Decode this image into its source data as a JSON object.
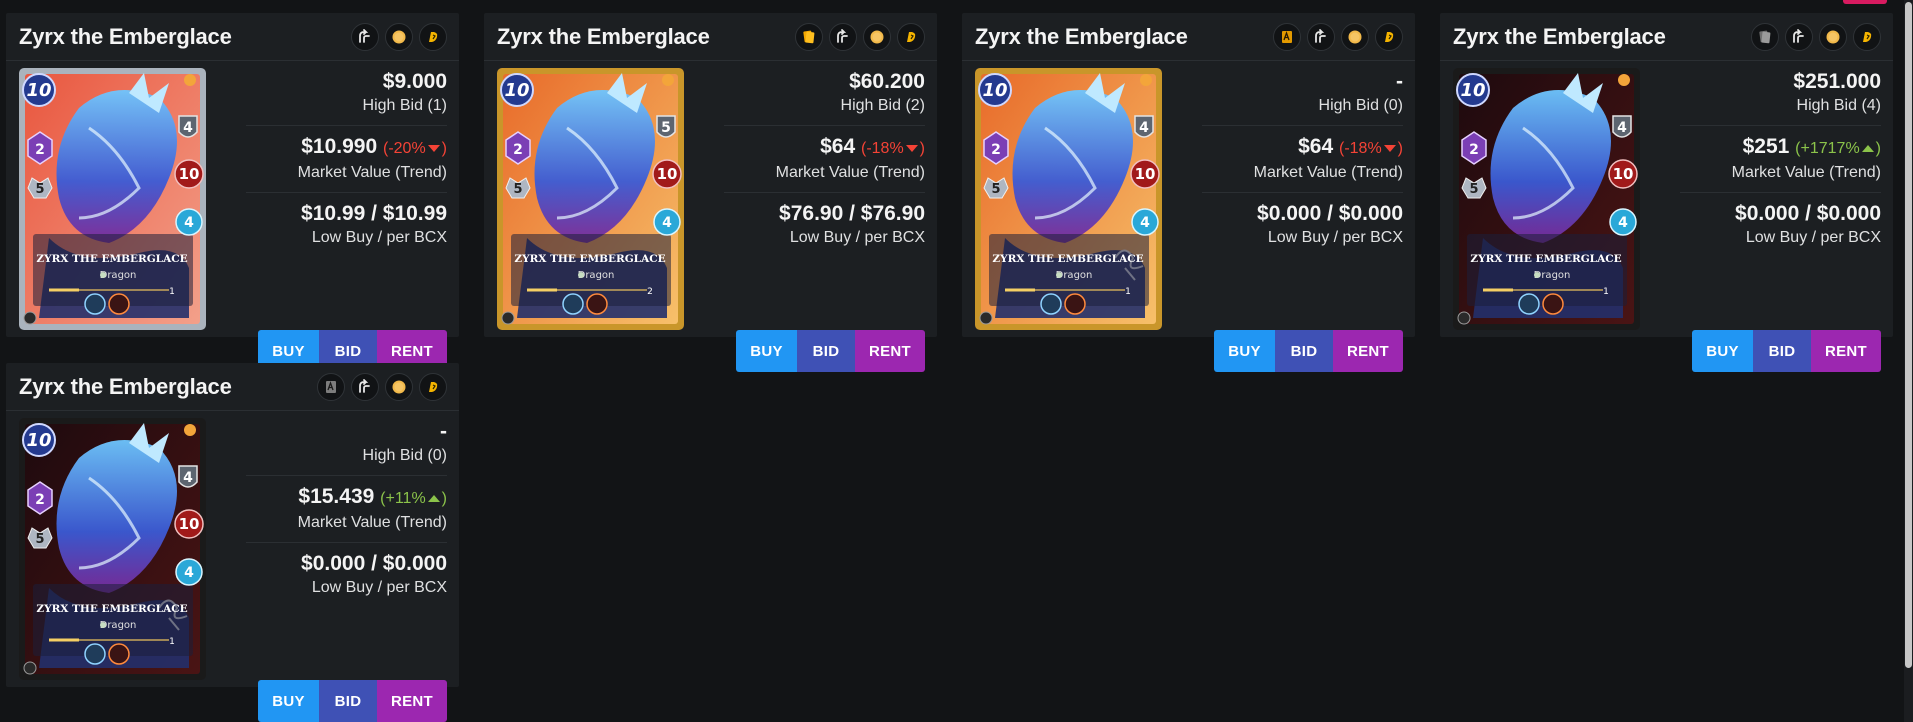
{
  "cards": [
    {
      "name": "Zyrx the Emberglace",
      "badges": [
        "splinterlands-icon",
        "credits-coin-icon",
        "dec-icon"
      ],
      "edition_variant": "alpha-silver",
      "card_art": {
        "mana": "10",
        "armor": "4",
        "magic": "2",
        "attack": "10",
        "speed": "5",
        "health": "4",
        "title": "ZYRX THE EMBERGLACE",
        "type": "Dragon",
        "level": "1"
      },
      "high_bid_price": "$9.000",
      "high_bid_label": "High Bid (1)",
      "market_value": "$10.990",
      "trend": "(-20%",
      "trend_dir": "down",
      "trend_close": ")",
      "market_label": "Market Value (Trend)",
      "low_buy": "$10.99 / $10.99",
      "low_buy_label": "Low Buy / per BCX"
    },
    {
      "name": "Zyrx the Emberglace",
      "badges": [
        "gold-card-icon",
        "splinterlands-icon",
        "credits-coin-icon",
        "dec-icon"
      ],
      "edition_variant": "gold",
      "card_art": {
        "mana": "10",
        "armor": "5",
        "magic": "2",
        "attack": "10",
        "speed": "5",
        "health": "4",
        "title": "ZYRX THE EMBERGLACE",
        "type": "Dragon",
        "level": "2"
      },
      "high_bid_price": "$60.200",
      "high_bid_label": "High Bid (2)",
      "market_value": "$64",
      "trend": "(-18%",
      "trend_dir": "down",
      "trend_close": ")",
      "market_label": "Market Value (Trend)",
      "low_buy": "$76.90 / $76.90",
      "low_buy_label": "Low Buy / per BCX"
    },
    {
      "name": "Zyrx the Emberglace",
      "badges": [
        "gold-signed-card-icon",
        "splinterlands-icon",
        "credits-coin-icon",
        "dec-icon"
      ],
      "edition_variant": "gold-signed",
      "card_art": {
        "mana": "10",
        "armor": "4",
        "magic": "2",
        "attack": "10",
        "speed": "5",
        "health": "4",
        "title": "ZYRX THE EMBERGLACE",
        "type": "Dragon",
        "level": "1"
      },
      "high_bid_price": "-",
      "high_bid_label": "High Bid (0)",
      "market_value": "$64",
      "trend": "(-18%",
      "trend_dir": "down",
      "trend_close": ")",
      "market_label": "Market Value (Trend)",
      "low_buy": "$0.000 / $0.000",
      "low_buy_label": "Low Buy / per BCX"
    },
    {
      "name": "Zyrx the Emberglace",
      "badges": [
        "black-card-icon",
        "splinterlands-icon",
        "credits-coin-icon",
        "dec-icon"
      ],
      "edition_variant": "black-foil",
      "card_art": {
        "mana": "10",
        "armor": "4",
        "magic": "2",
        "attack": "10",
        "speed": "5",
        "health": "4",
        "title": "ZYRX THE EMBERGLACE",
        "type": "Dragon",
        "level": "1"
      },
      "high_bid_price": "$251.000",
      "high_bid_label": "High Bid (4)",
      "market_value": "$251",
      "trend": "(+1717%",
      "trend_dir": "up",
      "trend_close": ")",
      "market_label": "Market Value (Trend)",
      "low_buy": "$0.000 / $0.000",
      "low_buy_label": "Low Buy / per BCX"
    },
    {
      "name": "Zyrx the Emberglace",
      "badges": [
        "black-signed-card-icon",
        "splinterlands-icon",
        "credits-coin-icon",
        "dec-icon"
      ],
      "edition_variant": "black-signed",
      "card_art": {
        "mana": "10",
        "armor": "4",
        "magic": "2",
        "attack": "10",
        "speed": "5",
        "health": "4",
        "title": "ZYRX THE EMBERGLACE",
        "type": "Dragon",
        "level": "1"
      },
      "high_bid_price": "-",
      "high_bid_label": "High Bid (0)",
      "market_value": "$15.439",
      "trend": "(+11%",
      "trend_dir": "up",
      "trend_close": ")",
      "market_label": "Market Value (Trend)",
      "low_buy": "$0.000 / $0.000",
      "low_buy_label": "Low Buy / per BCX"
    }
  ],
  "buttons": {
    "buy": "BUY",
    "bid": "BID",
    "rent": "RENT"
  },
  "colors": {
    "page_bg": "#121416",
    "card_bg": "#1c1f22",
    "buy": "#2196f3",
    "bid": "#3f51b5",
    "rent": "#9c27b0",
    "trend_down": "#f44336",
    "trend_up": "#8bc34a",
    "accent_tab": "#d81b60"
  }
}
